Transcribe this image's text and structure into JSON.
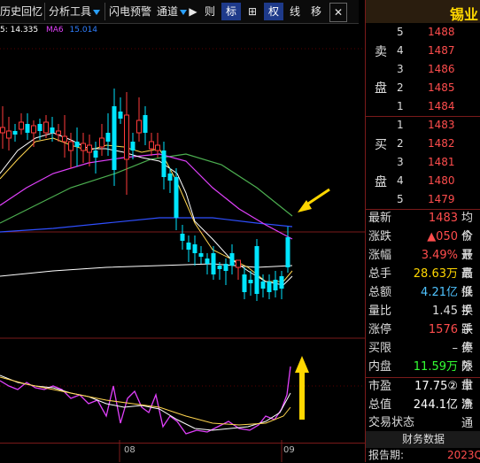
{
  "toolbar": {
    "history_recall": "历史回忆",
    "analysis_tools": "分析工具",
    "lightning_alert": "闪电预警",
    "channel": "通道",
    "btn_mark": "标",
    "btn_cross": "⊞",
    "btn_right": "权",
    "btn_move": "移",
    "btn_close": "✕"
  },
  "legend": {
    "prefix": "5: 14.335",
    "ma6_label": "MA6",
    "ma6_value": "15.014"
  },
  "dates": [
    "08",
    "09"
  ],
  "panel": {
    "stock_name": "锡业",
    "sell_label_1": "卖",
    "sell_label_2": "盘",
    "buy_label_1": "买",
    "buy_label_2": "盘",
    "sell": [
      {
        "level": "5",
        "price": "1488"
      },
      {
        "level": "4",
        "price": "1487"
      },
      {
        "level": "3",
        "price": "1486"
      },
      {
        "level": "2",
        "price": "1485"
      },
      {
        "level": "1",
        "price": "1484"
      }
    ],
    "buy": [
      {
        "level": "1",
        "price": "1483"
      },
      {
        "level": "2",
        "price": "1482"
      },
      {
        "level": "3",
        "price": "1481"
      },
      {
        "level": "4",
        "price": "1480"
      },
      {
        "level": "5",
        "price": "1479"
      }
    ],
    "quotes": [
      {
        "k": "最新",
        "v": "1483",
        "k2": "均价",
        "color": "#ff4d4d"
      },
      {
        "k": "涨跌",
        "v": "▲050",
        "k2": "今开",
        "color": "#ff4d4d"
      },
      {
        "k": "涨幅",
        "v": "3.49%",
        "k2": "最高",
        "color": "#ff4d4d"
      },
      {
        "k": "总手",
        "v": "28.63万",
        "k2": "最低",
        "color": "#ffd700"
      },
      {
        "k": "总额",
        "v": "4.21亿",
        "k2": "换手",
        "color": "#4fc3ff"
      },
      {
        "k": "量比",
        "v": "1.45",
        "k2": "换手",
        "color": "#ddd"
      },
      {
        "k": "涨停",
        "v": "1576",
        "k2": "跌停",
        "color": "#ff4d4d"
      },
      {
        "k": "买限",
        "v": "–",
        "k2": "卖限",
        "color": "#ddd"
      },
      {
        "k": "内盘",
        "v": "11.59万",
        "k2": "外盘",
        "color": "#33ff33"
      }
    ],
    "market_cap_label": "市盈",
    "market_cap_value": "17.75②",
    "market_cap_k2": "市净",
    "total_value_label": "总值",
    "total_value_value": "244.1亿",
    "total_value_k2": "流通",
    "trade_status": "交易状态",
    "finance_button": "财务数据",
    "report_label": "报告期:",
    "report_value": "2023Q"
  },
  "colors": {
    "up": "#ff3b3b",
    "down": "#00e5ff",
    "ma_white": "#ffffff",
    "ma_yellow": "#ffd54f",
    "ma_magenta": "#e040fb",
    "ma_green": "#4caf50",
    "ma_blue": "#2f4fff",
    "arrow": "#ffd700"
  }
}
